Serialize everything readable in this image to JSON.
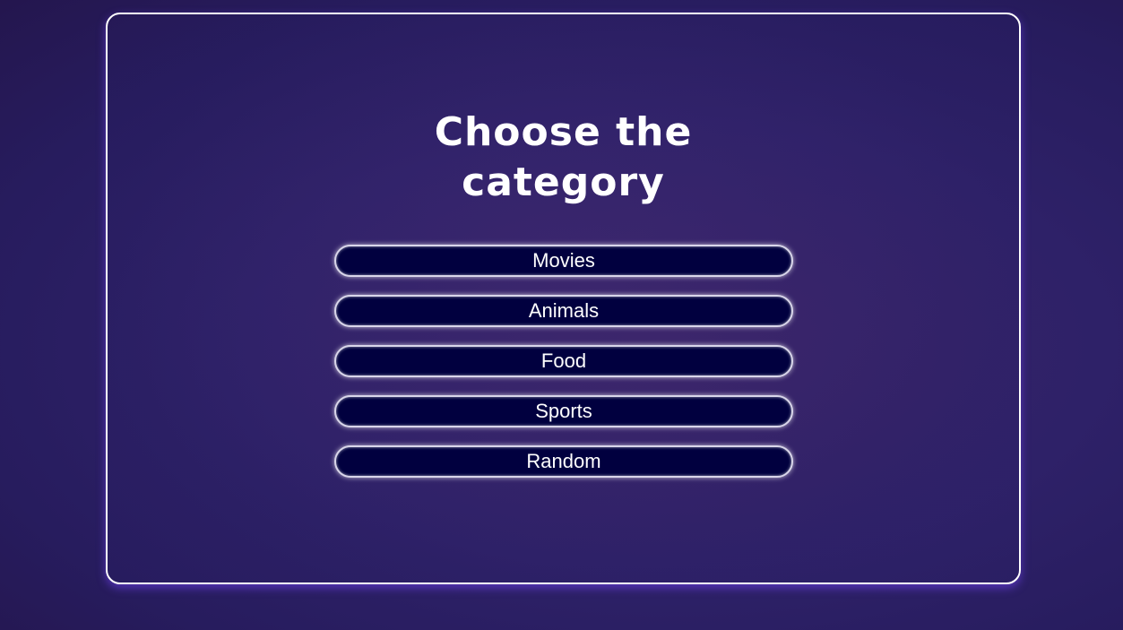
{
  "page": {
    "title_line1": "Choose the",
    "title_line2": "category"
  },
  "categories": [
    {
      "label": "Movies"
    },
    {
      "label": "Animals"
    },
    {
      "label": "Food"
    },
    {
      "label": "Sports"
    },
    {
      "label": "Random"
    }
  ],
  "colors": {
    "background": "#2e2168",
    "button_fill": "#01003f",
    "border": "#ffffff",
    "text": "#ffffff"
  }
}
